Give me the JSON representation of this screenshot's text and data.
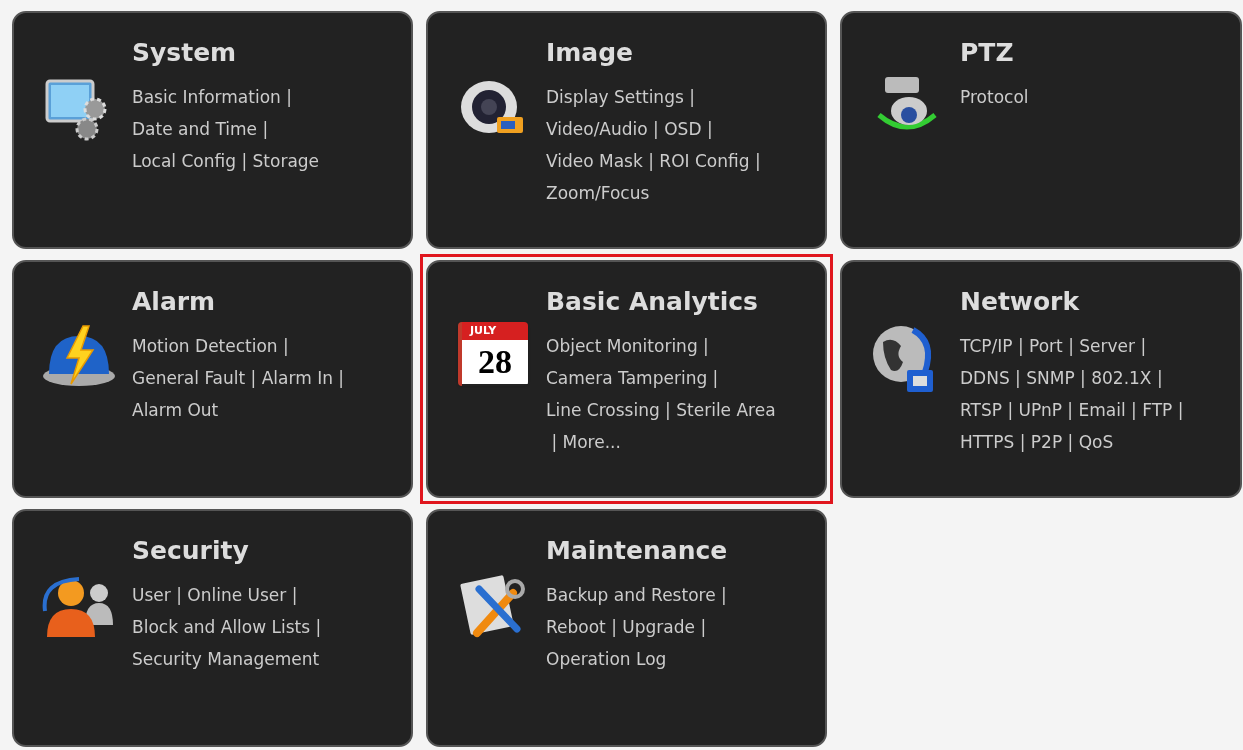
{
  "cards": [
    {
      "title": "System",
      "kind": "monitor-gear",
      "selected": false,
      "lines": [
        "Basic Information |",
        "Date and Time |",
        "Local Config | Storage"
      ]
    },
    {
      "title": "Image",
      "kind": "camera",
      "selected": false,
      "lines": [
        "Display Settings |",
        "Video/Audio | OSD |",
        "Video Mask | ROI Config |",
        "Zoom/Focus"
      ]
    },
    {
      "title": "PTZ",
      "kind": "ptz",
      "selected": false,
      "lines": [
        "Protocol"
      ]
    },
    {
      "title": "Alarm",
      "kind": "alarm",
      "selected": false,
      "lines": [
        "Motion Detection |",
        "General Fault | Alarm In |",
        "Alarm Out"
      ]
    },
    {
      "title": "Basic Analytics",
      "kind": "calendar",
      "icon_month": "JULY",
      "icon_day": "28",
      "selected": true,
      "lines": [
        "Object Monitoring |",
        "Camera Tampering |",
        "Line Crossing | Sterile Area",
        " | More..."
      ]
    },
    {
      "title": "Network",
      "kind": "globe",
      "selected": false,
      "lines": [
        "TCP/IP | Port | Server |",
        "DDNS | SNMP | 802.1X |",
        "RTSP | UPnP | Email | FTP |",
        "HTTPS | P2P | QoS"
      ]
    },
    {
      "title": "Security",
      "kind": "users",
      "selected": false,
      "lines": [
        "User | Online User |",
        "Block and Allow Lists |",
        "Security Management"
      ]
    },
    {
      "title": "Maintenance",
      "kind": "tools",
      "selected": false,
      "lines": [
        "Backup and Restore |",
        "Reboot | Upgrade |",
        "Operation Log"
      ]
    }
  ]
}
